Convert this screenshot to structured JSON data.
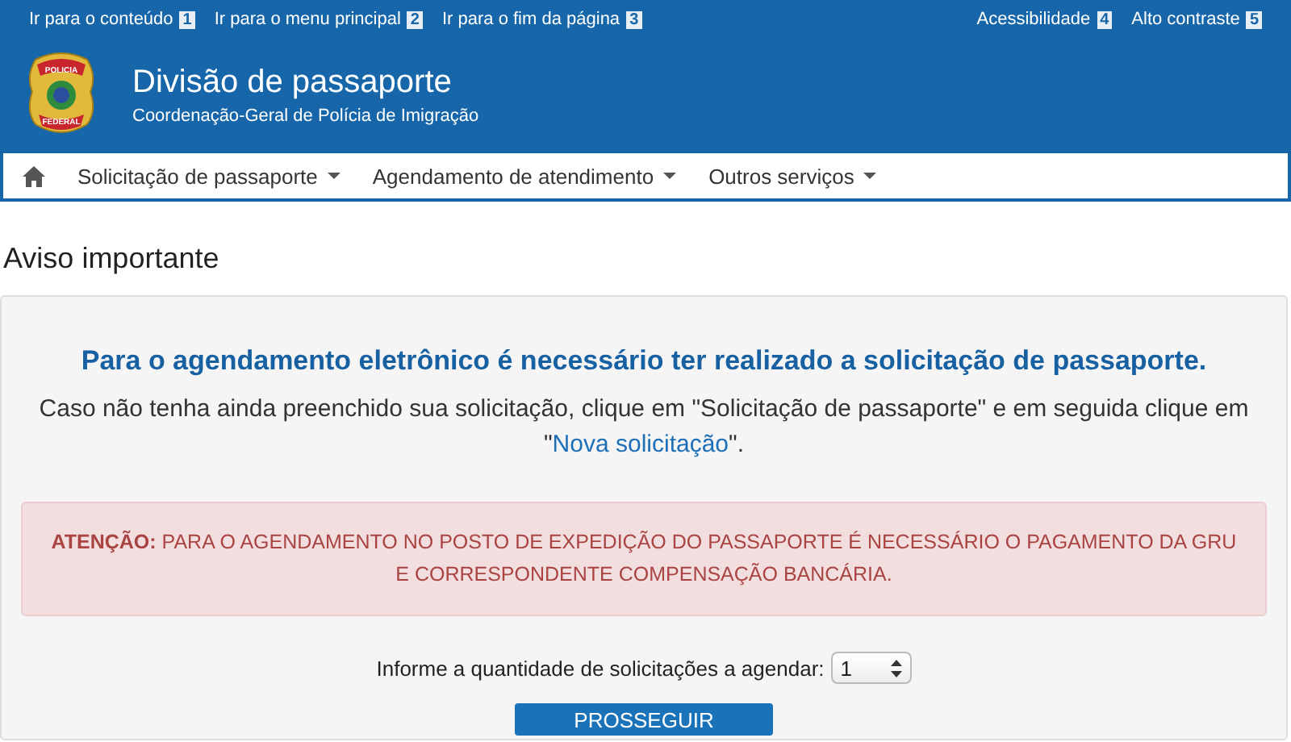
{
  "skip_links": [
    {
      "label": "Ir para o conteúdo",
      "key": "1"
    },
    {
      "label": "Ir para o menu principal",
      "key": "2"
    },
    {
      "label": "Ir para o fim da página",
      "key": "3"
    }
  ],
  "accessibility_links": [
    {
      "label": "Acessibilidade",
      "key": "4"
    },
    {
      "label": "Alto contraste",
      "key": "5"
    }
  ],
  "header": {
    "logo_top": "POLICIA",
    "logo_bottom": "FEDERAL",
    "title": "Divisão de passaporte",
    "subtitle": "Coordenação-Geral de Polícia de Imigração"
  },
  "nav": {
    "items": [
      {
        "label": "Solicitação de passaporte",
        "has_dropdown": true
      },
      {
        "label": "Agendamento de atendimento",
        "has_dropdown": true
      },
      {
        "label": "Outros serviços",
        "has_dropdown": true
      }
    ]
  },
  "page_title": "Aviso importante",
  "notice": {
    "headline": "Para o agendamento eletrônico é necessário ter realizado a solicitação de passaporte.",
    "text_before": "Caso não tenha ainda preenchido sua solicitação, clique em \"Solicitação de passaporte\" e em seguida clique em \"",
    "link": "Nova solicitação",
    "text_after": "\".",
    "alert": "**ATENÇÃO:** PARA O AGENDAMENTO NO POSTO DE EXPEDIÇÃO DO PASSAPORTE É NECESSÁRIO O PAGAMENTO DA GRU E CORRESPONDENTE COMPENSAÇÃO BANCÁRIA.",
    "quantity_label": "Informe a quantidade de solicitações a agendar:",
    "quantity_value": "1",
    "button": "PROSSEGUIR"
  }
}
